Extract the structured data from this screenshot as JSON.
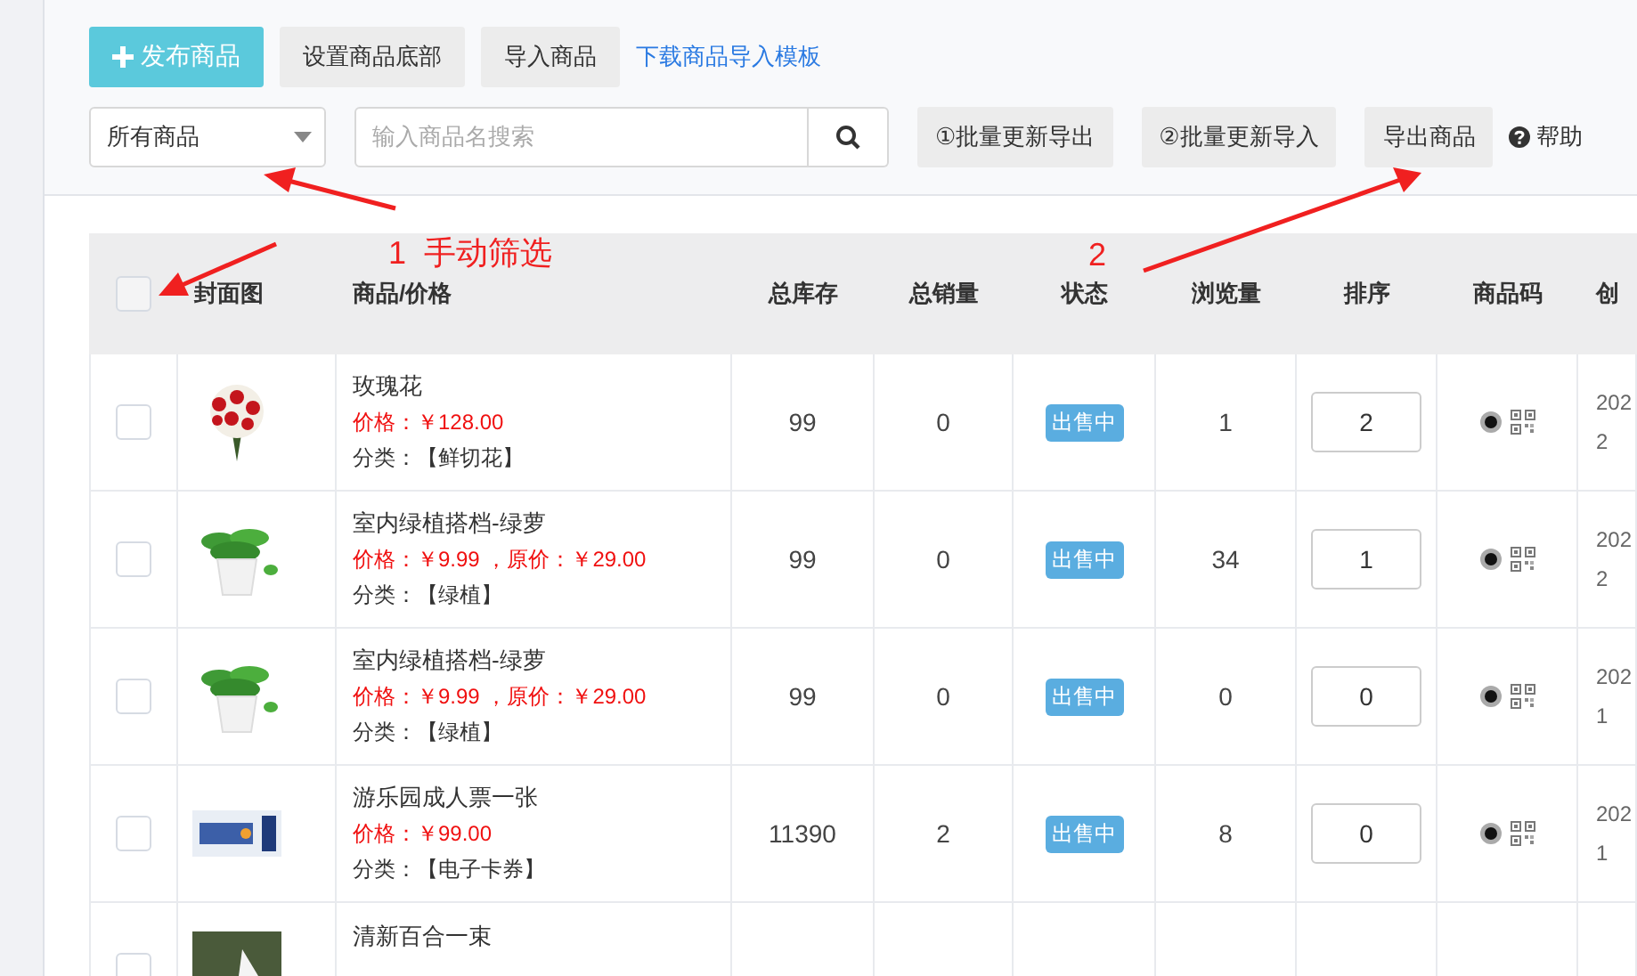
{
  "toolbar": {
    "buttons": [
      {
        "kind": "primary",
        "label": "发布商品"
      },
      {
        "kind": "default",
        "label": "设置商品底部"
      },
      {
        "kind": "default",
        "label": "导入商品"
      },
      {
        "kind": "link",
        "label": "下载商品导入模板"
      }
    ]
  },
  "filter": {
    "select": {
      "value": "所有商品"
    },
    "search": {
      "placeholder": "输入商品名搜索"
    },
    "buttons": [
      "①批量更新导出",
      "②批量更新导入",
      "导出商品"
    ],
    "help": "帮助"
  },
  "table": {
    "select_all": {
      "checked": false
    },
    "columns": [
      "封面图",
      "商品/价格",
      "总库存",
      "总销量",
      "状态",
      "浏览量",
      "排序",
      "商品码",
      "创"
    ],
    "rows": [
      {
        "checked": false,
        "name": "玫瑰花",
        "price": "价格：￥128.00",
        "category": "分类：【鲜切花】",
        "stock": "99",
        "sales": "0",
        "status": "出售中",
        "views": "1",
        "sort": "2",
        "date": [
          "202",
          "2"
        ]
      },
      {
        "checked": false,
        "name": "室内绿植搭档-绿萝",
        "price": "价格：￥9.99 ，原价：￥29.00",
        "category": "分类：【绿植】",
        "stock": "99",
        "sales": "0",
        "status": "出售中",
        "views": "34",
        "sort": "1",
        "date": [
          "202",
          "2"
        ]
      },
      {
        "checked": false,
        "name": "室内绿植搭档-绿萝",
        "price": "价格：￥9.99 ，原价：￥29.00",
        "category": "分类：【绿植】",
        "stock": "99",
        "sales": "0",
        "status": "出售中",
        "views": "0",
        "sort": "0",
        "date": [
          "202",
          "1"
        ]
      },
      {
        "checked": false,
        "name": "游乐园成人票一张",
        "price": "价格：￥99.00",
        "category": "分类：【电子卡券】",
        "stock": "11390",
        "sales": "2",
        "status": "出售中",
        "views": "8",
        "sort": "0",
        "date": [
          "202",
          "1"
        ]
      },
      {
        "checked": false,
        "name": "清新百合一束"
      }
    ]
  },
  "annotations": [
    {
      "text": "1  手动筛选"
    },
    {
      "text": "2"
    }
  ]
}
